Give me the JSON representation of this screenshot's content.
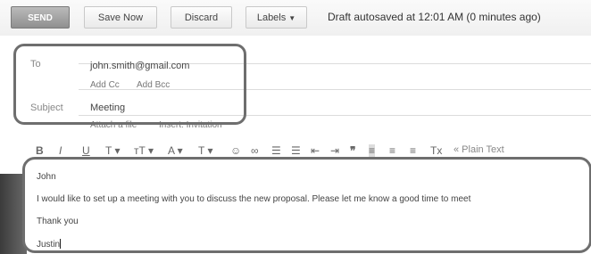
{
  "toolbar": {
    "send_label": "SEND",
    "save_label": "Save Now",
    "discard_label": "Discard",
    "labels_label": "Labels",
    "status": "Draft autosaved at 12:01 AM (0 minutes ago)"
  },
  "header": {
    "to_label": "To",
    "to_value": "john.smith@gmail.com",
    "add_cc": "Add Cc",
    "add_bcc": "Add Bcc",
    "subject_label": "Subject",
    "subject_value": "Meeting",
    "attach_link": "Attach a file",
    "invite_link": "Insert: Invitation"
  },
  "format_bar": {
    "plain_text": "« Plain Text"
  },
  "body": {
    "lines": [
      "John",
      "I would like to set up a meeting with you to discuss the new proposal. Please let me know a good time to meet",
      "Thank you",
      "Justin"
    ]
  },
  "colors": {
    "send_button": "#999999",
    "highlight_border": "#6e6e6e"
  }
}
